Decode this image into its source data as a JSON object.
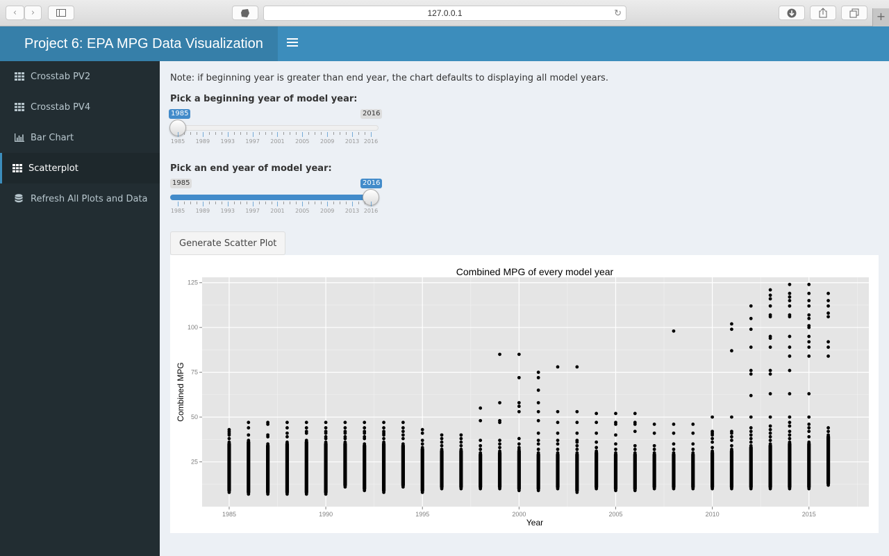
{
  "browser": {
    "url": "127.0.0.1",
    "icons": [
      "back-icon",
      "forward-icon",
      "sidebar-icon",
      "extension-icon",
      "reload-icon",
      "download-icon",
      "share-icon",
      "tabs-icon",
      "new-tab-icon"
    ]
  },
  "header": {
    "title": "Project 6: EPA MPG Data Visualization",
    "toggle_icon": "hamburger-menu-icon",
    "colors": {
      "bar": "#3c8dbc",
      "logo": "#367fa9"
    }
  },
  "sidebar": {
    "items": [
      {
        "label": "Crosstab PV2",
        "icon": "grid-icon",
        "active": false
      },
      {
        "label": "Crosstab PV4",
        "icon": "grid-icon",
        "active": false
      },
      {
        "label": "Bar Chart",
        "icon": "bar-chart-icon",
        "active": false
      },
      {
        "label": "Scatterplot",
        "icon": "grid-icon",
        "active": true
      },
      {
        "label": "Refresh All Plots and Data",
        "icon": "database-icon",
        "active": false
      }
    ]
  },
  "main": {
    "note": "Note: if beginning year is greater than end year, the chart defaults to displaying all model years.",
    "begin_slider": {
      "label": "Pick a beginning year of model year:",
      "min": 1985,
      "max": 2016,
      "value": 1985,
      "min_label": "1985",
      "max_label": "2016",
      "value_label": "1985",
      "tick_labels": [
        "1985",
        "1989",
        "1993",
        "1997",
        "2001",
        "2005",
        "2009",
        "2013",
        "2016"
      ]
    },
    "end_slider": {
      "label": "Pick an end year of model year:",
      "min": 1985,
      "max": 2016,
      "value": 2016,
      "min_label": "1985",
      "max_label": "2016",
      "value_label": "2016",
      "tick_labels": [
        "1985",
        "1989",
        "1993",
        "1997",
        "2001",
        "2005",
        "2009",
        "2013",
        "2016"
      ]
    },
    "generate_button": "Generate Scatter Plot"
  },
  "chart_data": {
    "type": "scatter",
    "title": "Combined MPG of every model year",
    "xlabel": "Year",
    "ylabel": "Combined MPG",
    "xlim": [
      1983.6,
      2018.1
    ],
    "ylim": [
      0,
      128
    ],
    "x_ticks": [
      1985,
      1990,
      1995,
      2000,
      2005,
      2010,
      2015
    ],
    "y_ticks": [
      25,
      50,
      75,
      100,
      125
    ],
    "grid": true,
    "legend": "none",
    "description": "Each model year has a dense vertical band of points (range min..max) plus sparse outlier points.",
    "years": [
      {
        "year": 1985,
        "band": [
          8,
          36
        ],
        "points": [
          38,
          40,
          41,
          42,
          43
        ]
      },
      {
        "year": 1986,
        "band": [
          7,
          37
        ],
        "points": [
          40,
          44,
          47
        ]
      },
      {
        "year": 1987,
        "band": [
          7,
          35
        ],
        "points": [
          39,
          40,
          46,
          47
        ]
      },
      {
        "year": 1988,
        "band": [
          7,
          36
        ],
        "points": [
          39,
          41,
          44,
          47
        ]
      },
      {
        "year": 1989,
        "band": [
          7,
          37
        ],
        "points": [
          41,
          42,
          44,
          47
        ]
      },
      {
        "year": 1990,
        "band": [
          7,
          36
        ],
        "points": [
          38,
          39,
          41,
          42,
          44,
          47
        ]
      },
      {
        "year": 1991,
        "band": [
          11,
          36
        ],
        "points": [
          38,
          39,
          41,
          42,
          44,
          47
        ]
      },
      {
        "year": 1992,
        "band": [
          9,
          35
        ],
        "points": [
          38,
          39,
          41,
          42,
          44,
          47
        ]
      },
      {
        "year": 1993,
        "band": [
          8,
          36
        ],
        "points": [
          38,
          40,
          41,
          42,
          44,
          47
        ]
      },
      {
        "year": 1994,
        "band": [
          11,
          35
        ],
        "points": [
          38,
          40,
          42,
          44,
          47
        ]
      },
      {
        "year": 1995,
        "band": [
          8,
          33
        ],
        "points": [
          35,
          37,
          41,
          43
        ]
      },
      {
        "year": 1996,
        "band": [
          10,
          32
        ],
        "points": [
          34,
          36,
          38,
          40
        ]
      },
      {
        "year": 1997,
        "band": [
          10,
          32
        ],
        "points": [
          34,
          36,
          38,
          40
        ]
      },
      {
        "year": 1998,
        "band": [
          10,
          30
        ],
        "points": [
          32,
          34,
          37,
          48,
          55
        ]
      },
      {
        "year": 1999,
        "band": [
          10,
          31
        ],
        "points": [
          33,
          35,
          37,
          47,
          48,
          58,
          85
        ]
      },
      {
        "year": 2000,
        "band": [
          9,
          32
        ],
        "points": [
          33,
          35,
          38,
          53,
          56,
          58,
          72,
          85
        ]
      },
      {
        "year": 2001,
        "band": [
          9,
          30
        ],
        "points": [
          32,
          35,
          37,
          41,
          48,
          53,
          58,
          65,
          72,
          75
        ]
      },
      {
        "year": 2002,
        "band": [
          10,
          30
        ],
        "points": [
          32,
          35,
          37,
          41,
          47,
          53,
          78
        ]
      },
      {
        "year": 2003,
        "band": [
          8,
          30
        ],
        "points": [
          32,
          34,
          36,
          37,
          41,
          47,
          53,
          78
        ]
      },
      {
        "year": 2004,
        "band": [
          10,
          31
        ],
        "points": [
          33,
          36,
          41,
          47,
          52
        ]
      },
      {
        "year": 2005,
        "band": [
          9,
          30
        ],
        "points": [
          32,
          35,
          40,
          46,
          47,
          52
        ]
      },
      {
        "year": 2006,
        "band": [
          9,
          30
        ],
        "points": [
          32,
          34,
          42,
          46,
          47,
          52
        ]
      },
      {
        "year": 2007,
        "band": [
          10,
          30
        ],
        "points": [
          32,
          34,
          41,
          46
        ]
      },
      {
        "year": 2008,
        "band": [
          10,
          30
        ],
        "points": [
          32,
          35,
          41,
          46,
          98
        ]
      },
      {
        "year": 2009,
        "band": [
          10,
          30
        ],
        "points": [
          32,
          35,
          41,
          46
        ]
      },
      {
        "year": 2010,
        "band": [
          10,
          31
        ],
        "points": [
          33,
          36,
          38,
          40,
          41,
          42,
          50
        ]
      },
      {
        "year": 2011,
        "band": [
          10,
          32
        ],
        "points": [
          34,
          37,
          39,
          41,
          42,
          50,
          87,
          99,
          102
        ]
      },
      {
        "year": 2012,
        "band": [
          10,
          34
        ],
        "points": [
          36,
          38,
          40,
          42,
          44,
          50,
          62,
          74,
          76,
          89,
          99,
          105,
          112
        ]
      },
      {
        "year": 2013,
        "band": [
          10,
          35
        ],
        "points": [
          37,
          39,
          41,
          43,
          45,
          50,
          63,
          74,
          76,
          89,
          94,
          95,
          106,
          107,
          112,
          116,
          118,
          121
        ]
      },
      {
        "year": 2014,
        "band": [
          10,
          36
        ],
        "points": [
          38,
          40,
          42,
          45,
          47,
          50,
          63,
          76,
          84,
          89,
          95,
          106,
          107,
          112,
          115,
          117,
          119,
          124
        ]
      },
      {
        "year": 2015,
        "band": [
          10,
          36
        ],
        "points": [
          39,
          42,
          44,
          46,
          50,
          63,
          84,
          89,
          92,
          95,
          100,
          101,
          105,
          107,
          112,
          115,
          119,
          124
        ]
      },
      {
        "year": 2016,
        "band": [
          12,
          40
        ],
        "points": [
          42,
          44,
          84,
          89,
          92,
          106,
          108,
          112,
          115,
          119
        ]
      }
    ]
  }
}
